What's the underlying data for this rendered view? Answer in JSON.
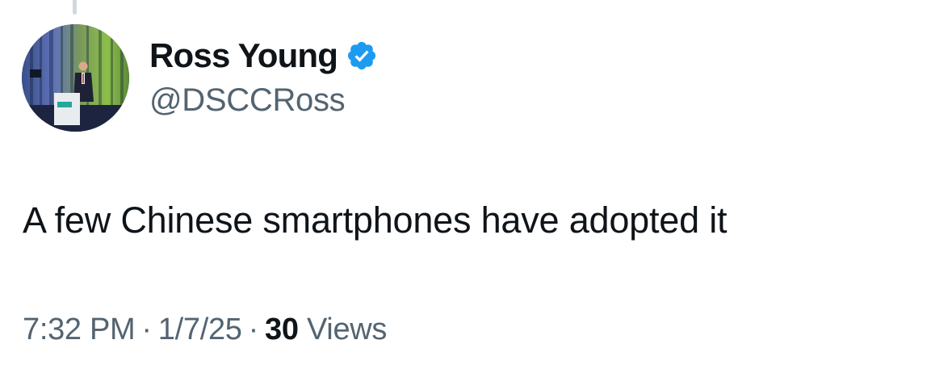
{
  "tweet": {
    "author": {
      "display_name": "Ross Young",
      "handle": "@DSCCRoss",
      "verified_icon": "verified-badge-icon",
      "avatar_icon": "speaker-at-podium-avatar"
    },
    "text": "A few Chinese smartphones have adopted it",
    "meta": {
      "time": "7:32 PM",
      "separator": "·",
      "date": "1/7/25",
      "views_count": "30",
      "views_label": "Views"
    }
  },
  "colors": {
    "text_primary": "#0f1419",
    "text_secondary": "#536471",
    "verified_blue": "#1d9bf0",
    "thread_line": "#cfd9de",
    "background": "#ffffff"
  }
}
